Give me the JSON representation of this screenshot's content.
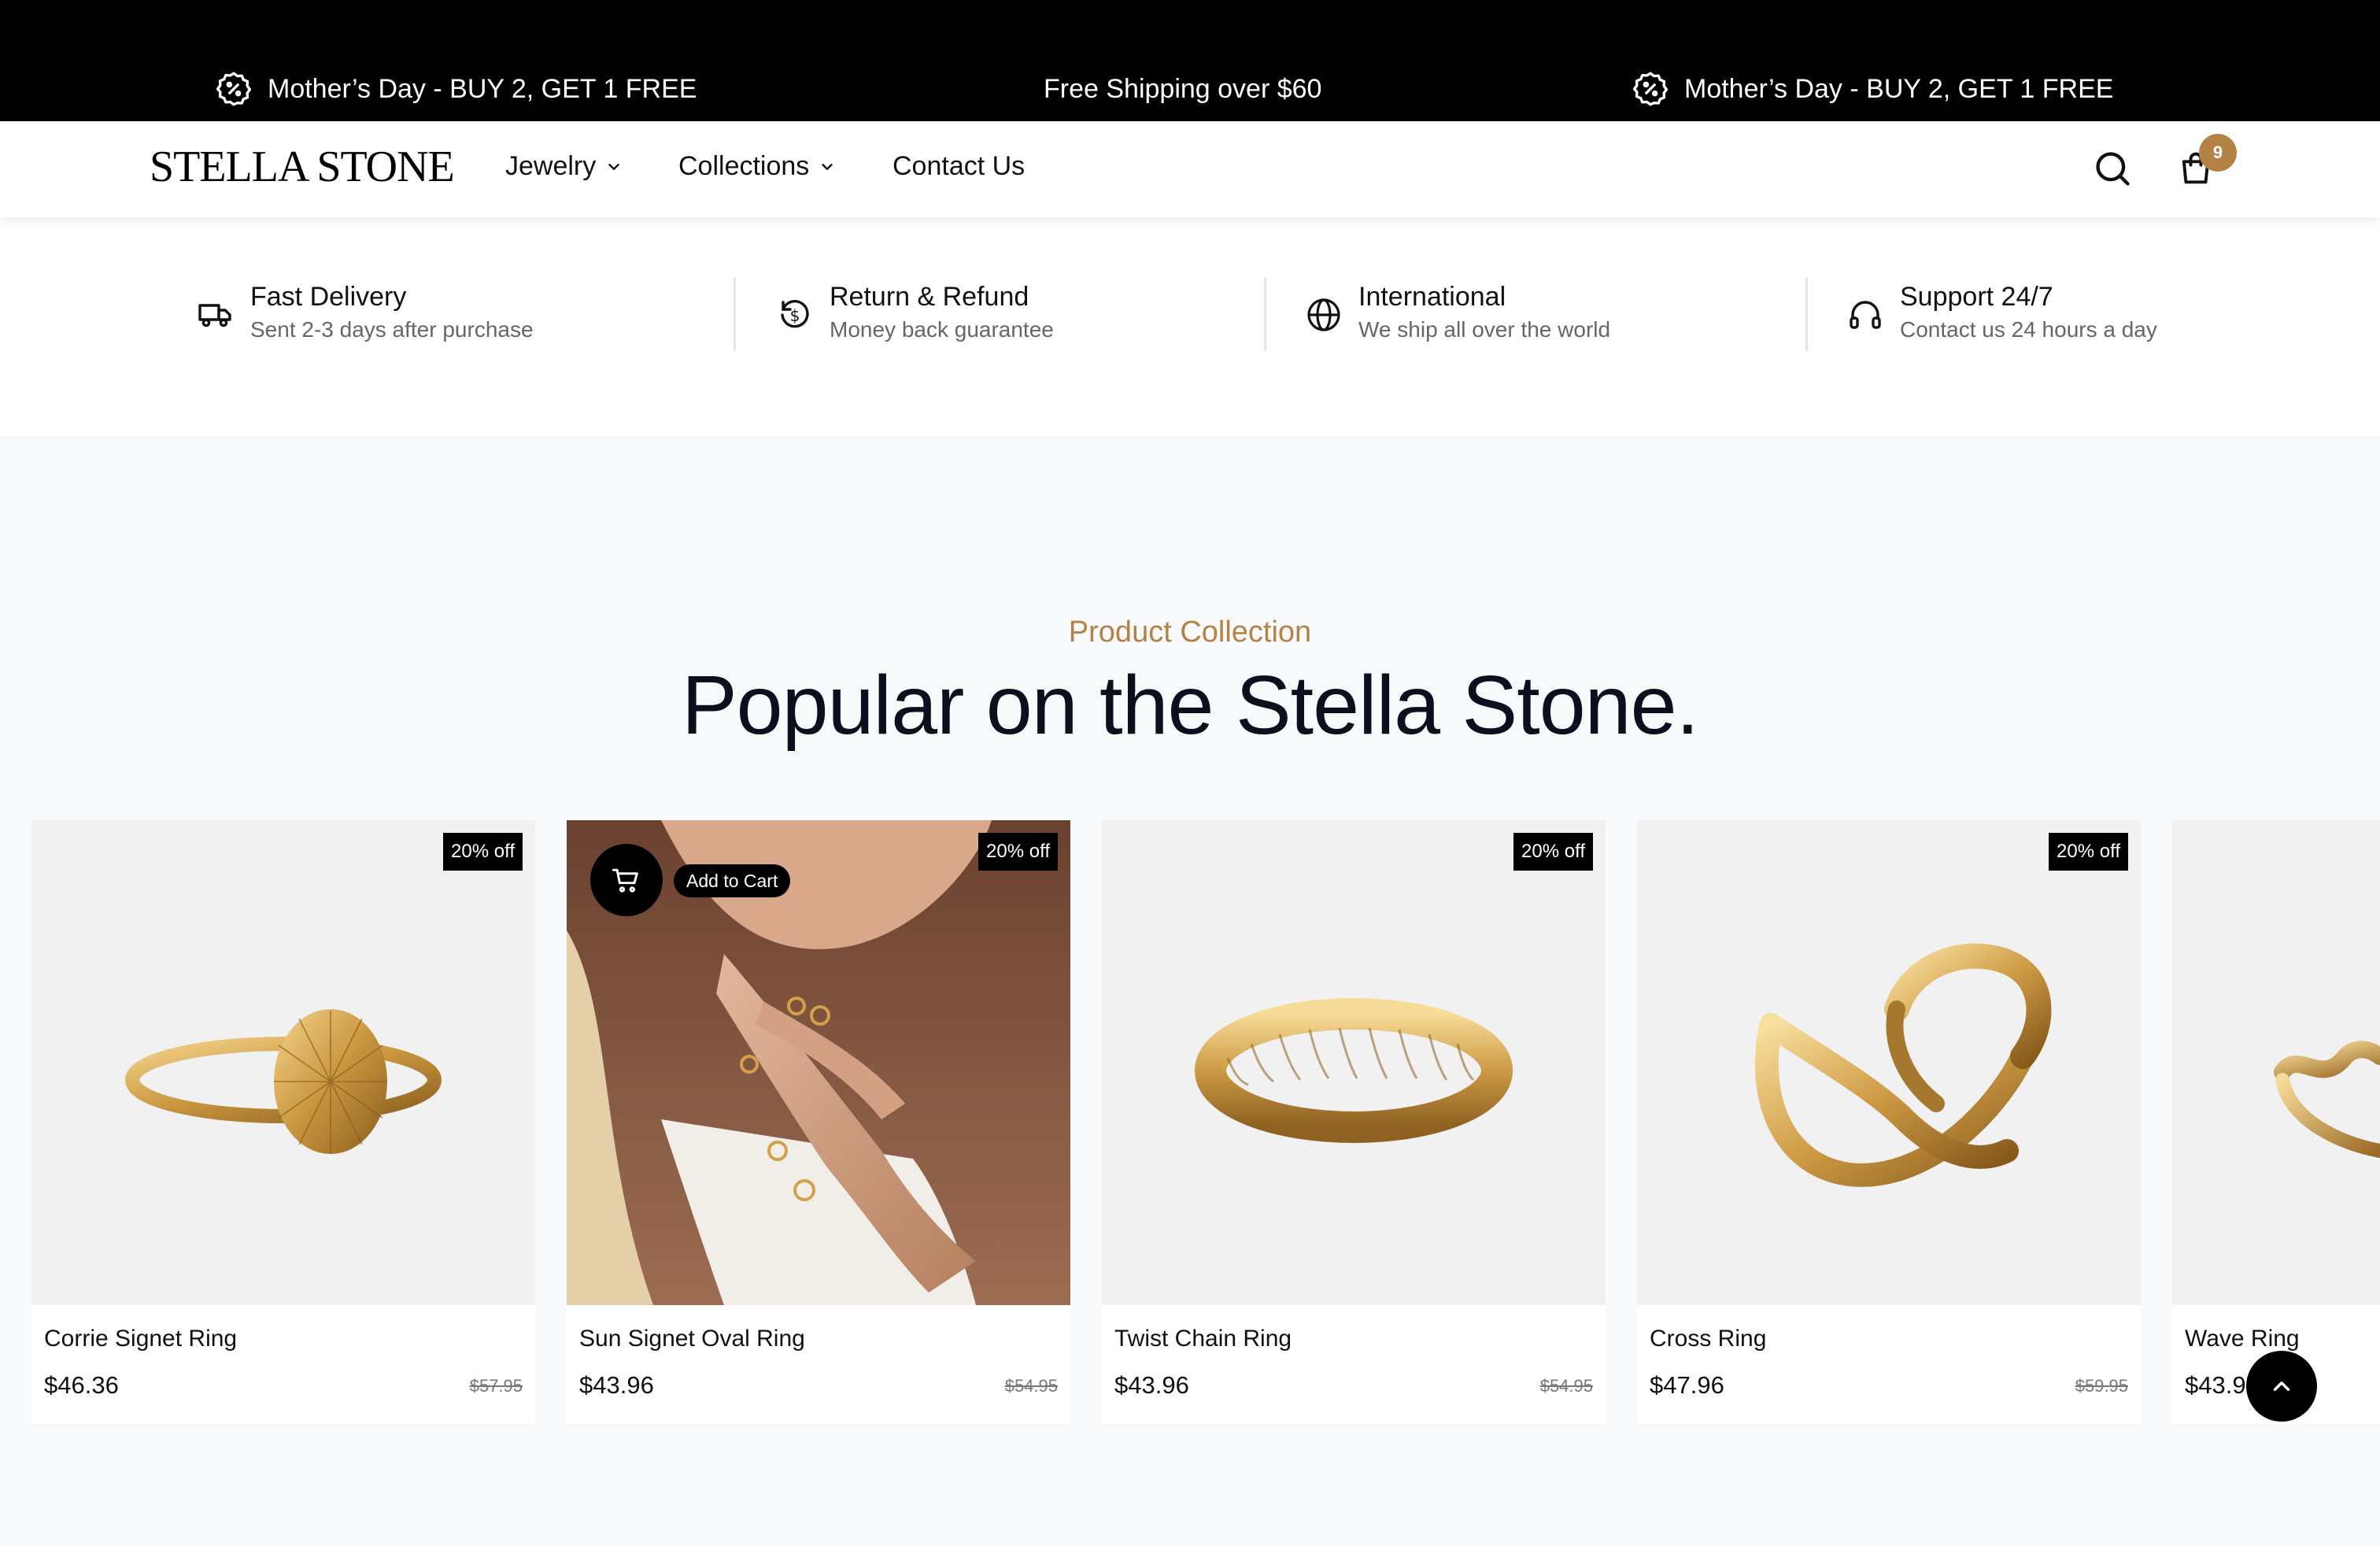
{
  "announcement": {
    "left": "Mother’s Day - BUY 2, GET 1 FREE",
    "center": "Free Shipping over $60",
    "right": "Mother’s Day - BUY 2, GET 1 FREE",
    "icon": "discount-badge-icon"
  },
  "header": {
    "logo": "STELLA STONE",
    "nav": [
      {
        "label": "Jewelry",
        "has_dropdown": true
      },
      {
        "label": "Collections",
        "has_dropdown": true
      },
      {
        "label": "Contact Us",
        "has_dropdown": false
      }
    ],
    "cart_count": "9",
    "icons": [
      "search-icon",
      "shopping-bag-icon"
    ]
  },
  "features": [
    {
      "title": "Fast Delivery",
      "subtitle": "Sent 2-3 days after purchase",
      "icon": "truck-icon"
    },
    {
      "title": "Return & Refund",
      "subtitle": "Money back guarantee",
      "icon": "refund-icon"
    },
    {
      "title": "International",
      "subtitle": "We ship all over the world",
      "icon": "globe-icon"
    },
    {
      "title": "Support 24/7",
      "subtitle": "Contact us 24 hours a day",
      "icon": "headphones-icon"
    }
  ],
  "collection": {
    "eyebrow": "Product Collection",
    "heading": "Popular on the Stella Stone."
  },
  "products": [
    {
      "name": "Corrie Signet Ring",
      "price": "$46.36",
      "old_price": "$57.95",
      "badge": "20% off"
    },
    {
      "name": "Sun Signet Oval Ring",
      "price": "$43.96",
      "old_price": "$54.95",
      "badge": "20% off",
      "hover_action": "Add to Cart"
    },
    {
      "name": "Twist Chain Ring",
      "price": "$43.96",
      "old_price": "$54.95",
      "badge": "20% off"
    },
    {
      "name": "Cross Ring",
      "price": "$47.96",
      "old_price": "$59.95",
      "badge": "20% off"
    },
    {
      "name": "Wave Ring",
      "price": "$43.9"
    }
  ],
  "colors": {
    "accent": "#b58246",
    "announcement_bg": "#000000",
    "heading": "#0d0f1e",
    "section_bg": "#f8f9fa"
  }
}
